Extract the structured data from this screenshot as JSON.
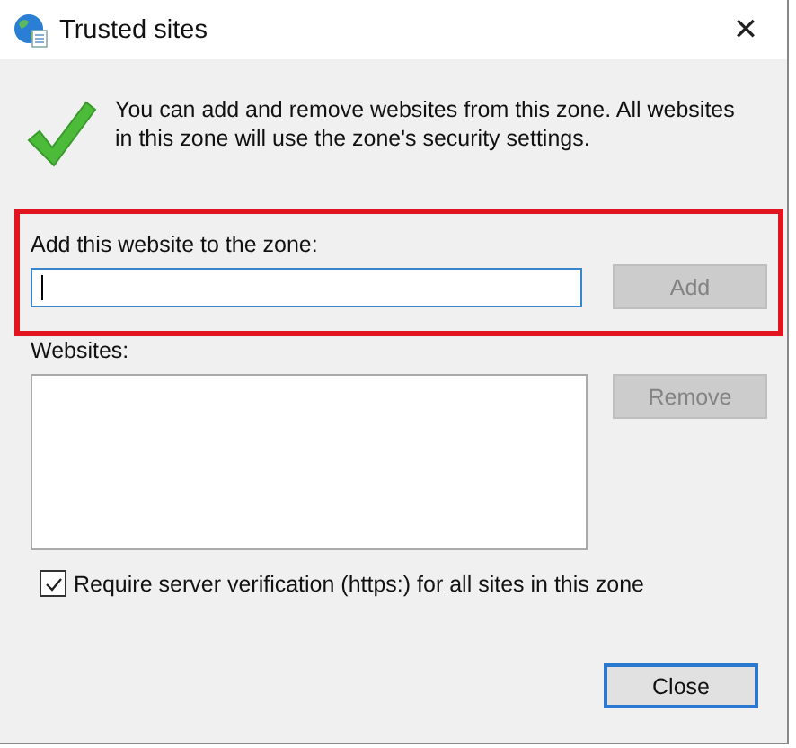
{
  "window": {
    "title": "Trusted sites",
    "close_glyph": "✕"
  },
  "info": {
    "text": "You can add and remove websites from this zone. All websites in this zone will use the zone's security settings."
  },
  "add_section": {
    "highlighted": true,
    "label": "Add this website to the zone:",
    "field": {
      "focused": true
    },
    "button": {
      "label": "Add",
      "disabled": true
    }
  },
  "websites": {
    "label": "Websites:",
    "remove_button": {
      "label": "Remove",
      "disabled": true
    }
  },
  "https_option": {
    "label": "Require server verification (https:) for all sites in this zone",
    "checked": true
  },
  "close_button": {
    "label": "Close",
    "disabled": false,
    "default": true
  }
}
